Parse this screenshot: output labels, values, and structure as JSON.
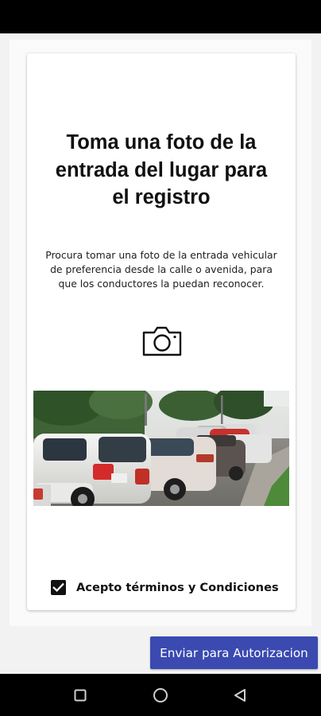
{
  "registration": {
    "title_lines": [
      "Toma una foto de la",
      "entrada del lugar para",
      "el registro"
    ],
    "description_lines": [
      "Procura tomar una foto de la entrada vehicular",
      "de preferencia desde la calle o avenida, para",
      "que los conductores la puedan reconocer."
    ],
    "camera_icon": "camera-icon",
    "photo_subject": "parking-lot-photo"
  },
  "terms": {
    "label": "Acepto términos y Condiciones",
    "checked": true
  },
  "submit_label": "Enviar para Autorizacion",
  "navigation": {
    "recents_icon": "square-icon",
    "home_icon": "circle-icon",
    "back_icon": "triangle-back-icon"
  },
  "colors": {
    "primary_button": "#3a4ab0",
    "status_bar": "#000000",
    "card_background": "#ffffff"
  }
}
